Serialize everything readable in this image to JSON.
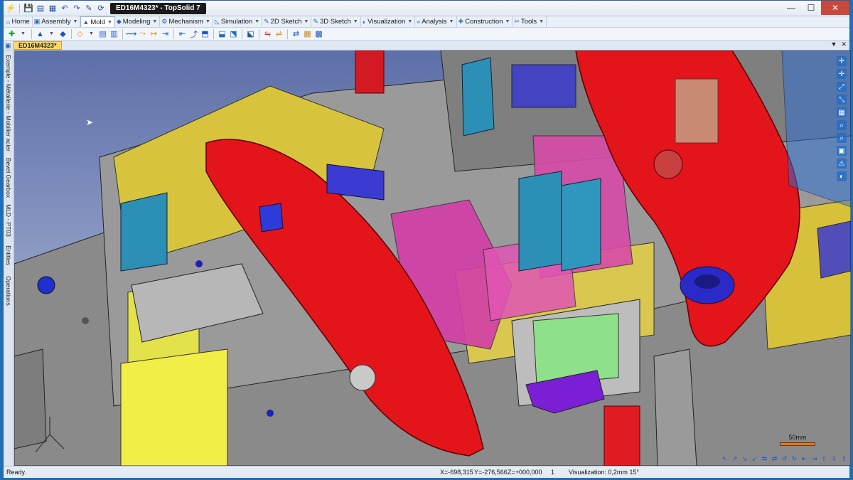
{
  "window": {
    "document_title": "ED16M4323* - TopSolid 7",
    "minimize": "—",
    "maximize": "☐",
    "close": "✕"
  },
  "quick_access": [
    "⚡",
    "💾",
    "▤",
    "▦",
    "↶",
    "↷",
    "✎",
    "⟳"
  ],
  "ribbon_tabs": [
    {
      "label": "Home",
      "icon": "⌂"
    },
    {
      "label": "Assembly",
      "icon": "▣"
    },
    {
      "label": "Mold",
      "icon": "▲"
    },
    {
      "label": "Modeling",
      "icon": "◆"
    },
    {
      "label": "Mechanism",
      "icon": "⚙"
    },
    {
      "label": "Simulation",
      "icon": "◺"
    },
    {
      "label": "2D Sketch",
      "icon": "✎"
    },
    {
      "label": "3D Sketch",
      "icon": "✎"
    },
    {
      "label": "Visualization",
      "icon": "◐"
    },
    {
      "label": "Analysis",
      "icon": "≈"
    },
    {
      "label": "Construction",
      "icon": "✚"
    },
    {
      "label": "Tools",
      "icon": "✂"
    }
  ],
  "active_tab": "Mold",
  "corner_icons": [
    "⚙",
    "?"
  ],
  "tools": [
    "✚",
    "▼",
    "▲",
    "▼",
    "◆",
    "◇",
    "▼",
    "▤",
    "▥",
    "⟿",
    "⤳",
    "↦",
    "⇥",
    "⇤",
    "⤴",
    "⬒",
    "⬓",
    "⬔",
    "⬕",
    "⇋",
    "⇌",
    "⇄",
    "▦",
    "▩"
  ],
  "document_tab": {
    "label": "ED16M4323*"
  },
  "side_tabs": [
    "Exemple - Métallerie - Mobilier acier",
    "Bevel Gearbox",
    "MLD - PT03",
    "Entities",
    "Operations"
  ],
  "view_tools": [
    "✛",
    "✛",
    "⤢",
    "⤡",
    "▦",
    "⌕",
    "⌕",
    "▣",
    "⚠",
    "◐"
  ],
  "scale_label": "50mm",
  "nav_icons": [
    "↖",
    "↗",
    "↘",
    "↙",
    "⇆",
    "⇄",
    "↺",
    "↻",
    "⇤",
    "⇥",
    "⇧",
    "⇩",
    "⇪"
  ],
  "status": {
    "ready": "Ready.",
    "x": "X=-698,315",
    "y": "Y=-276,566",
    "z": "Z=+000,000",
    "count": "1",
    "visualization": "Visualization: 0,2mm 15°"
  },
  "colors": {
    "frame_blue": "#1f6fb8",
    "close_red": "#c94a3c",
    "doc_tab_yellow": "#ffd966",
    "part_red": "#e3141a",
    "plate_grey": "#8e8e8e",
    "plate_yellow": "#d8c43c",
    "insert_magenta": "#d33ea8",
    "insert_teal": "#2c8fb5"
  }
}
